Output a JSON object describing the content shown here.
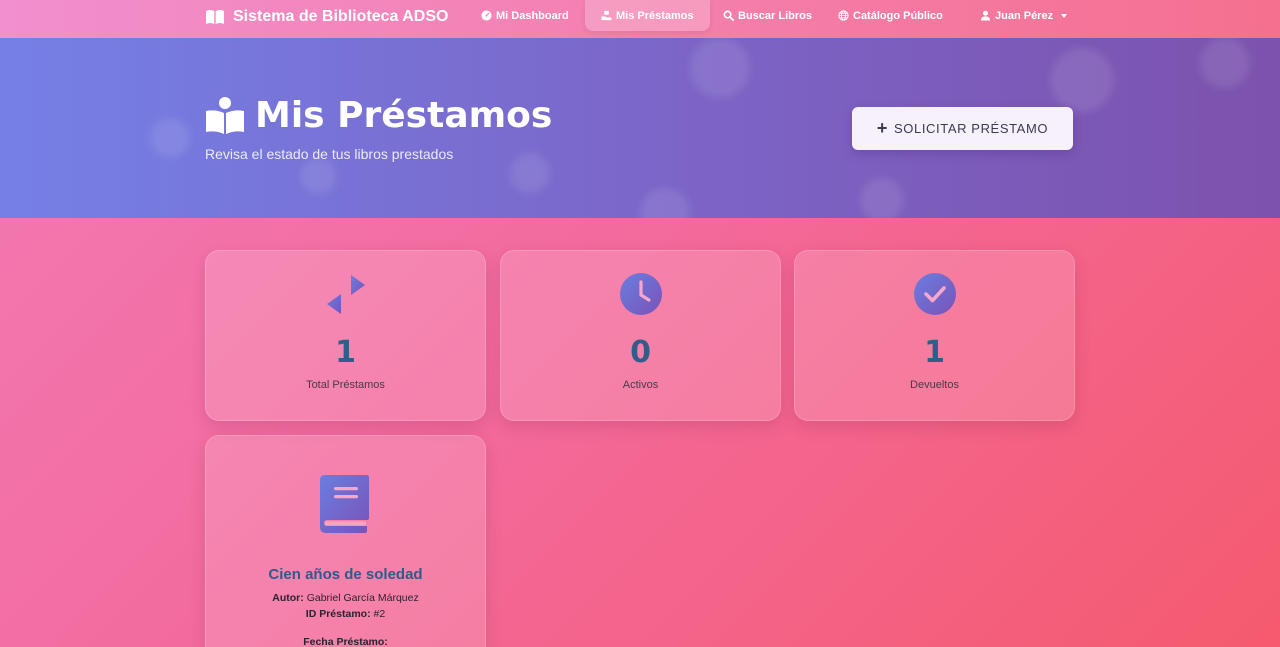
{
  "navbar": {
    "brand": "Sistema de Biblioteca ADSO",
    "items": [
      {
        "label": "Mi Dashboard",
        "icon": "dashboard-icon"
      },
      {
        "label": "Mis Préstamos",
        "icon": "loan-hand-icon",
        "active": true
      },
      {
        "label": "Buscar Libros",
        "icon": "search-icon"
      },
      {
        "label": "Catálogo Público",
        "icon": "globe-icon"
      }
    ],
    "user": {
      "label": "Juan Pérez",
      "icon": "user-icon"
    }
  },
  "hero": {
    "title": "Mis Préstamos",
    "subtitle": "Revisa el estado de tus libros prestados",
    "button_label": "SOLICITAR PRÉSTAMO",
    "button_icon": "plus-icon"
  },
  "stats": [
    {
      "value": "1",
      "label": "Total Préstamos",
      "icon": "exchange-arrows-icon"
    },
    {
      "value": "0",
      "label": "Activos",
      "icon": "clock-icon"
    },
    {
      "value": "1",
      "label": "Devueltos",
      "icon": "check-circle-icon"
    }
  ],
  "loans": [
    {
      "title": "Cien años de soledad",
      "author_label": "Autor:",
      "author": "Gabriel García Márquez",
      "id_label": "ID Préstamo:",
      "id": "#2",
      "date_label": "Fecha Préstamo:",
      "icon": "book-icon"
    }
  ],
  "colors": {
    "accent_purple": "#7a5fd0",
    "stat_number": "#2f5e8a",
    "hero_start": "#7580e6",
    "hero_end": "#7c52ad"
  }
}
